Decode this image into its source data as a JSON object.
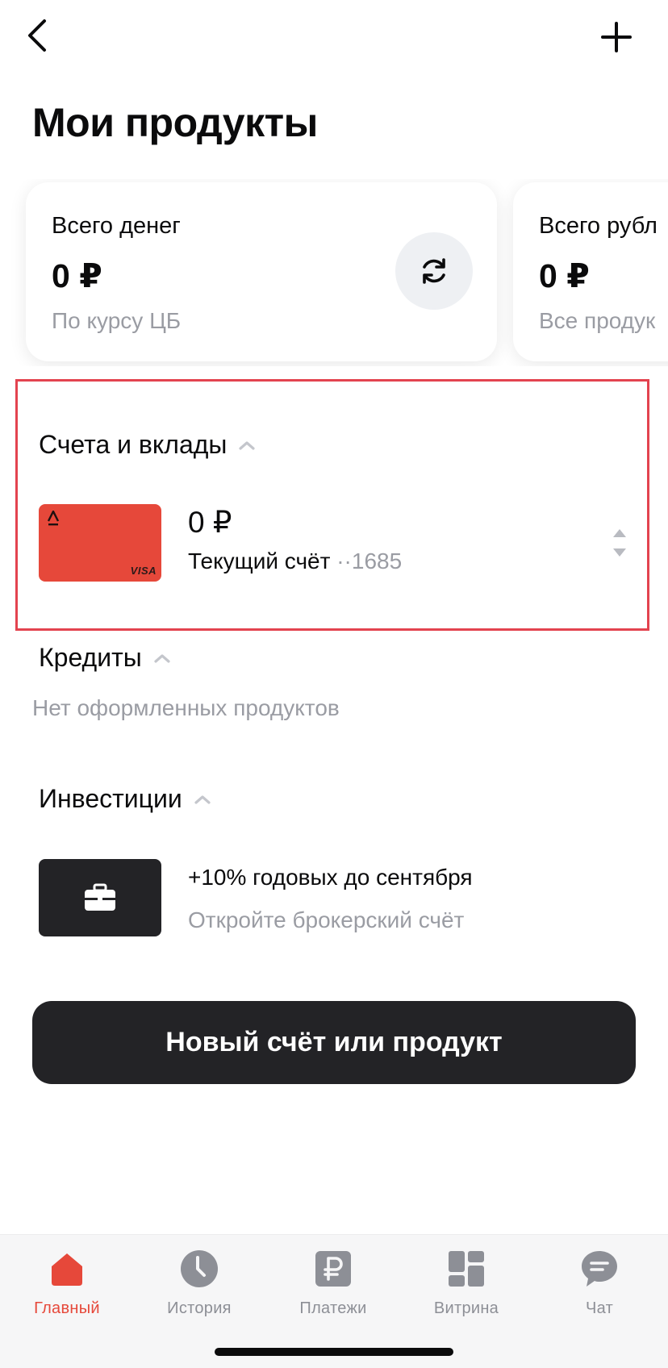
{
  "header": {
    "title": "Мои продукты",
    "back_icon": "chevron-left-icon",
    "add_icon": "plus-icon"
  },
  "summary_cards": [
    {
      "label": "Всего денег",
      "amount": "0 ₽",
      "sub": "По курсу ЦБ",
      "action_icon": "refresh-icon"
    },
    {
      "label": "Всего рубл",
      "amount": "0 ₽",
      "sub": "Все продук"
    }
  ],
  "accounts_section": {
    "title": "Счета и вклады",
    "items": [
      {
        "amount": "0 ₽",
        "name": "Текущий счёт",
        "mask": "··1685",
        "card_brand": "VISA",
        "card_color": "#e6483a"
      }
    ]
  },
  "credits_section": {
    "title": "Кредиты",
    "empty_text": "Нет оформленных продуктов"
  },
  "investments_section": {
    "title": "Инвестиции",
    "promo_title": "+10% годовых до сентября",
    "promo_sub": "Откройте брокерский счёт",
    "promo_icon": "briefcase-icon"
  },
  "new_product_button": "Новый счёт или продукт",
  "tabbar": {
    "active_color": "#e6483a",
    "items": [
      {
        "label": "Главный",
        "icon": "home-icon",
        "active": true
      },
      {
        "label": "История",
        "icon": "clock-icon",
        "active": false
      },
      {
        "label": "Платежи",
        "icon": "ruble-icon",
        "active": false
      },
      {
        "label": "Витрина",
        "icon": "showcase-icon",
        "active": false
      },
      {
        "label": "Чат",
        "icon": "chat-icon",
        "active": false
      }
    ]
  },
  "colors": {
    "accent": "#e6483a",
    "highlight_border": "#e3434f",
    "dark": "#232326",
    "secondary_text": "#9a9ca3"
  }
}
